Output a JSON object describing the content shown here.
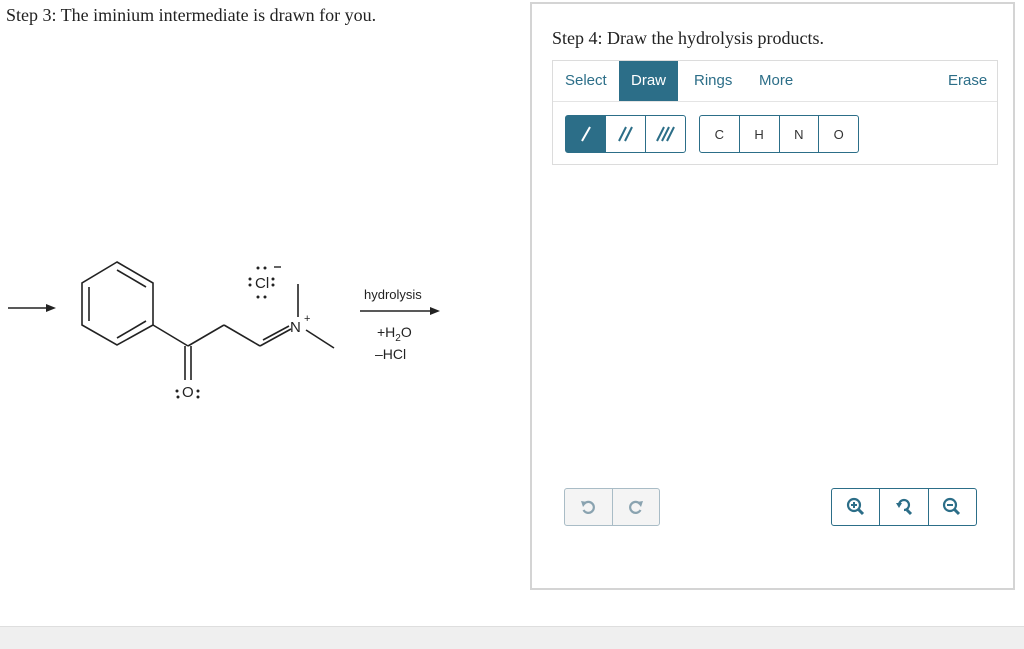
{
  "step3": {
    "title": "Step 3: The iminium intermediate is drawn for you."
  },
  "molecule": {
    "chloride_label": "Cl",
    "nitrogen_label": "N",
    "nitrogen_charge": "+",
    "oxygen_label": "O",
    "arrow_label_top": "hydrolysis",
    "reagent_1_pre": "+H",
    "reagent_1_sub": "2",
    "reagent_1_post": "O",
    "reagent_2": "–HCl"
  },
  "step4": {
    "title": "Step 4: Draw the hydrolysis products."
  },
  "toolbar": {
    "tabs": [
      "Select",
      "Draw",
      "Rings",
      "More",
      "Erase"
    ],
    "active_tab": "Draw",
    "atoms": [
      "C",
      "H",
      "N",
      "O"
    ]
  },
  "icons": {
    "bonds": [
      "single-bond-icon",
      "double-bond-icon",
      "triple-bond-icon"
    ],
    "history": [
      "undo-icon",
      "redo-icon"
    ],
    "zoom": [
      "zoom-in-icon",
      "reset-zoom-icon",
      "zoom-out-icon"
    ]
  },
  "colors": {
    "accent": "#2c6e88",
    "disabled": "#a9bcc6"
  }
}
